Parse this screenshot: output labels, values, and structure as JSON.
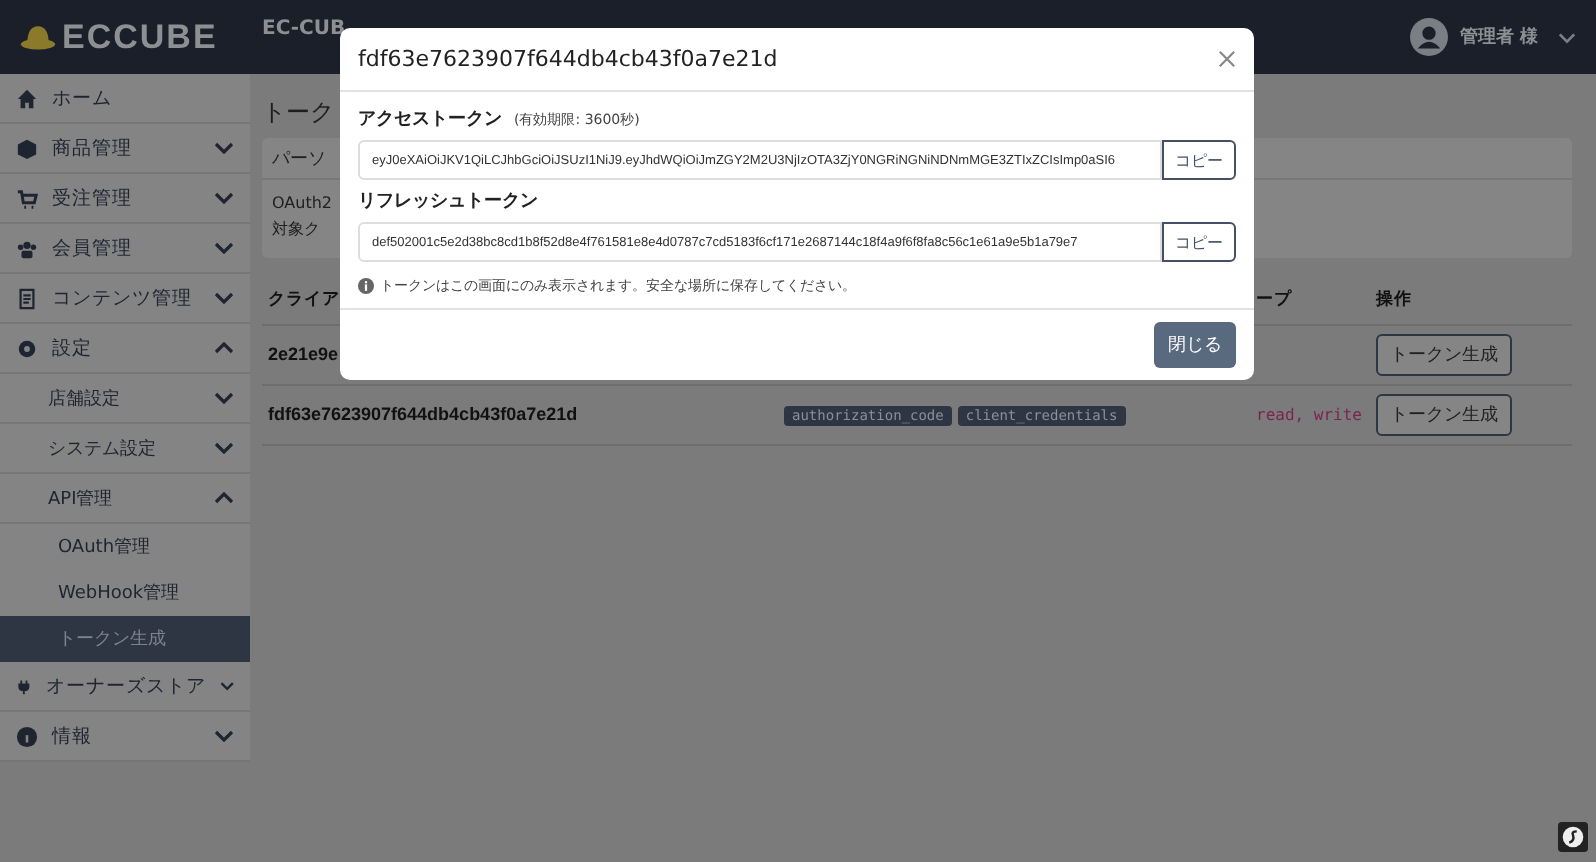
{
  "header": {
    "logo": "ECCUBE",
    "shop_name": "EC-CUB",
    "user": "管理者 様"
  },
  "sidebar": {
    "items": [
      {
        "label": "ホーム",
        "selected": false
      },
      {
        "label": "商品管理",
        "expanded": false,
        "selected": false
      },
      {
        "label": "受注管理",
        "expanded": false,
        "selected": false
      },
      {
        "label": "会員管理",
        "expanded": false,
        "selected": false
      },
      {
        "label": "コンテンツ管理",
        "expanded": false,
        "selected": false
      },
      {
        "label": "設定",
        "expanded": true,
        "selected": false,
        "children": [
          {
            "label": "店舗設定",
            "expanded": false,
            "selected": false
          },
          {
            "label": "システム設定",
            "expanded": false,
            "selected": false
          },
          {
            "label": "API管理",
            "expanded": true,
            "selected": false,
            "children": [
              {
                "label": "OAuth管理",
                "selected": false
              },
              {
                "label": "WebHook管理",
                "selected": false
              },
              {
                "label": "トークン生成",
                "selected": true
              }
            ]
          }
        ]
      },
      {
        "label": "オーナーズストア",
        "expanded": false,
        "selected": false
      },
      {
        "label": "情報",
        "expanded": false,
        "selected": false
      }
    ]
  },
  "page": {
    "title": "トーク",
    "card_header": "パーソ",
    "card_lines": [
      "OAuth2",
      "対象ク"
    ]
  },
  "table": {
    "columns": [
      "クライア",
      "ープ",
      "操作"
    ],
    "rows": [
      {
        "client": "2e21e9e",
        "action": "トークン生成"
      },
      {
        "client": "fdf63e7623907f644db4cb43f0a7e21d",
        "grants": [
          "authorization_code",
          "client_credentials"
        ],
        "scopes": "read, write",
        "action": "トークン生成"
      }
    ]
  },
  "modal": {
    "title": "fdf63e7623907f644db4cb43f0a7e21d",
    "fields": [
      {
        "label": "アクセストークン",
        "note": "(有効期限: 3600秒)",
        "value": "eyJ0eXAiOiJKV1QiLCJhbGciOiJSUzI1NiJ9.eyJhdWQiOiJmZGY2M2U3NjIzOTA3ZjY0NGRiNGNiNDNmMGE3ZTIxZCIsImp0aSI6",
        "button": "コピー"
      },
      {
        "label": "リフレッシュトークン",
        "value": "def502001c5e2d38bc8cd1b8f52d8e4f761581e8e4d0787c7cd5183f6cf171e2687144c18f4a9f6f8fa8c56c1e61a9e5b1a79e7",
        "button": "コピー"
      }
    ],
    "info": "トークンはこの画面にのみ表示されます。安全な場所に保存してください。",
    "close_button": "閉じる"
  }
}
